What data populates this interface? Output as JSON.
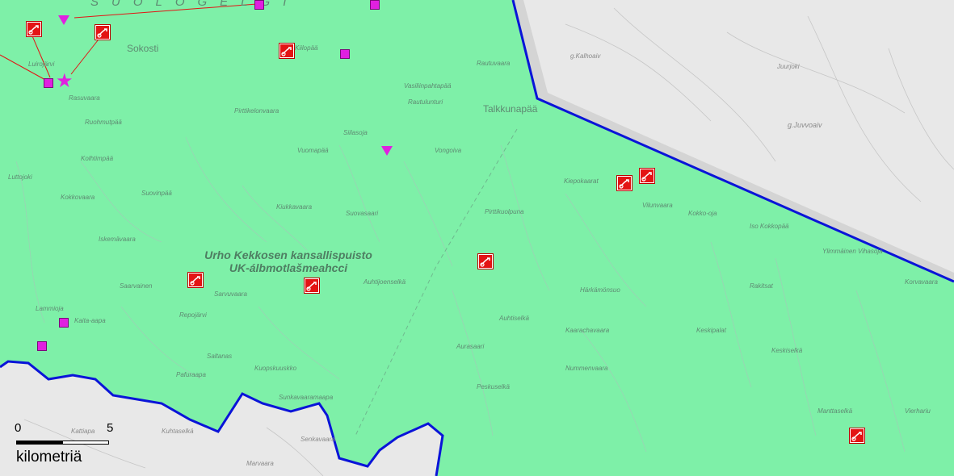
{
  "colors": {
    "park_fill": "#7ef0a8",
    "outside": "#e8e8e8",
    "border_line": "#0a14d8",
    "rescue_marker": "#e31414",
    "poi_magenta": "#e020e0"
  },
  "region_label": "SUOLOGELGI",
  "park": {
    "name_line1": "Urho Kekkosen kansallispuisto",
    "name_line2": "UK-álbmotlašmeahcci"
  },
  "labels": {
    "sokosti": "Sokosti",
    "talkkunapaa": "Talkkunapää",
    "vongoiva": "Vongoiva",
    "vuomapaa": "Vuomapää",
    "rautulunturi": "Rautulunturi",
    "kalhoaiv": "g.Kalhoaiv",
    "juvvoaiv": "g.Juvvoaiv",
    "juurujoki": "Juurjoki",
    "kiilopaa": "Kiilopää",
    "luirojarvi": "Luirojärvi",
    "rasuvaara": "Rasuvaara",
    "ruohmutpaa": "Ruohmutpää",
    "kolhtimpaa": "Kolhtimpää",
    "kokkovaara": "Kokkovaara",
    "suoviinpaa": "Suovinpää",
    "kiukkavaara": "Kiukkavaara",
    "iskemavaara": "Iskemävaara",
    "sarvuvaara": "Sarvuvaara",
    "aurasaari": "Aurasaari",
    "auhtijoenselka": "Auhtijoenselkä",
    "auhtiselka": "Auhtiselkä",
    "harkamonsuo": "Härkämönsuo",
    "rakitsat": "Rakitsat",
    "kesipalat": "Keskipalat",
    "kaarachavaara": "Kaarachavaara",
    "nummenvaara": "Nummenvaara",
    "kesiselka": "Keskiselkä",
    "manttaselka": "Manttaselkä",
    "peskuselka": "Peskuselkä",
    "saltanas": "Saltanas",
    "pafuraapa": "Pafuraapa",
    "kuopskuuskko": "Kuopskuuskko",
    "sunkavaaramaapa": "Sunkavaaramaapa",
    "senkavaara": "Senkavaara",
    "kuhtaselka": "Kuhtaselkä",
    "marvaara": "Marvaara",
    "kattiapa": "Kattiapa",
    "vierhariu": "Vierhariu",
    "korvavaara": "Korvavaara",
    "sarvainomi": "Saarvainen",
    "lamminoja": "Lammioja",
    "kaitajarvi": "Kaita-aapa",
    "repojarvi": "Repojärvi",
    "lutto": "Luttojoki",
    "kiepokaarat": "Kiepokaarat",
    "iakokko": "Iso Kokkopää",
    "viluvaara": "Vilunvaara",
    "kokkooja": "Kokko-oja",
    "ylimmaisvi": "Ylimmäinen Vihasoja",
    "pirttikuolpuna": "Pirttikuolpuna",
    "suovasaari": "Suovasaari",
    "sihoj": "Siilasoja",
    "pirttiselka": "Pirttikelonvaara",
    "rautulkaa": "Rautuvaara",
    "puolimatkanselka": "Vasiliinpahtapää"
  },
  "scale": {
    "zero": "0",
    "five": "5",
    "unit": "kilometriä"
  },
  "markers": {
    "rescue": "rescue-station-icon",
    "poi_square": "hut-square-icon",
    "poi_triangle": "shelter-triangle-icon",
    "poi_star": "star-icon"
  }
}
